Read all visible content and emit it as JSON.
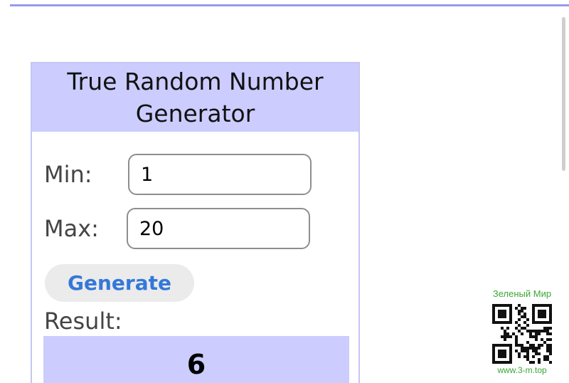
{
  "widget": {
    "title": "True Random Number Generator",
    "min_label": "Min:",
    "min_value": "1",
    "max_label": "Max:",
    "max_value": "20",
    "generate_label": "Generate",
    "result_label": "Result:",
    "result_value": "6"
  },
  "watermark": {
    "title": "Зеленый Мир",
    "url": "www.3-m.top"
  },
  "colors": {
    "title_background": "#ccccff",
    "accent_button_text": "#3478d8",
    "watermark_green": "#3aa635"
  }
}
